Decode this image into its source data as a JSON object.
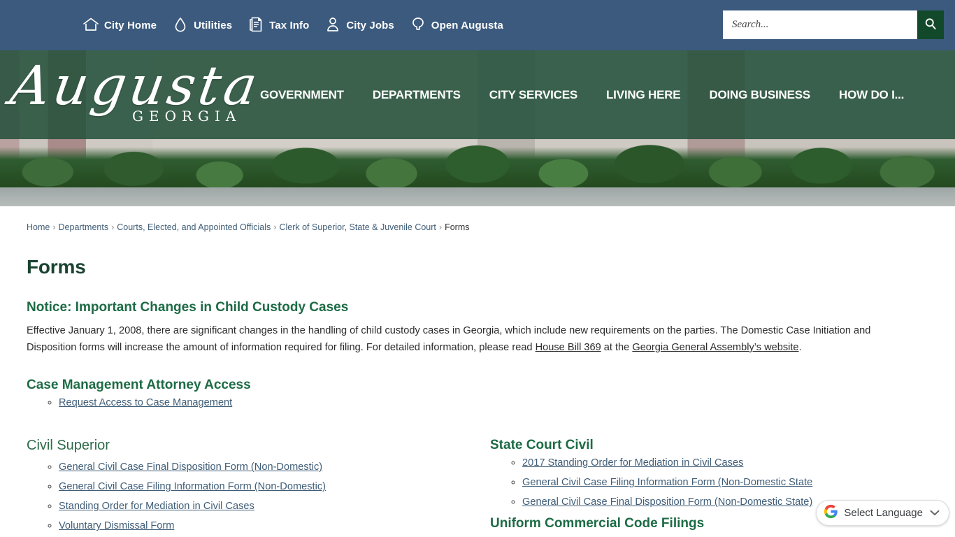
{
  "topbar": {
    "background": "#3b5a7e",
    "quick_links": [
      {
        "label": "City Home",
        "icon": "home-icon"
      },
      {
        "label": "Utilities",
        "icon": "water-drop-icon"
      },
      {
        "label": "Tax Info",
        "icon": "document-icon"
      },
      {
        "label": "City Jobs",
        "icon": "person-icon"
      },
      {
        "label": "Open Augusta",
        "icon": "tree-icon"
      }
    ],
    "search": {
      "placeholder": "Search...",
      "value": "",
      "button_icon": "search-icon",
      "button_color": "#13492b"
    }
  },
  "banner": {
    "logo_script": "Augusta",
    "logo_sub": "GEORGIA",
    "overlay_color": "#224f39",
    "nav": [
      {
        "label": "GOVERNMENT"
      },
      {
        "label": "DEPARTMENTS"
      },
      {
        "label": "CITY SERVICES"
      },
      {
        "label": "LIVING HERE"
      },
      {
        "label": "DOING BUSINESS"
      },
      {
        "label": "HOW DO I..."
      }
    ]
  },
  "breadcrumb": {
    "items": [
      "Home",
      "Departments",
      "Courts, Elected, and Appointed Officials",
      "Clerk of Superior, State & Juvenile Court"
    ],
    "current": "Forms",
    "separator": "›"
  },
  "main": {
    "page_title": "Forms",
    "notice": {
      "heading": "Notice: Important Changes in Child Custody Cases",
      "paragraph_part1": "Effective January 1, 2008, there are significant changes in the handling of child custody cases in Georgia, which include new requirements on the parties. The Domestic Case Initiation and Disposition forms will increase the amount of information required for filing. For detailed information, please read ",
      "link1": "House Bill 369",
      "paragraph_part2": " at the ",
      "link2": "Georgia General Assembly’s website",
      "paragraph_part3": "."
    },
    "case_management": {
      "heading": "Case Management Attorney Access",
      "links": [
        "Request Access to Case Management"
      ]
    },
    "columns": {
      "left": {
        "heading": "Civil Superior",
        "links": [
          "General Civil Case Final Disposition Form (Non-Domestic)",
          "General Civil Case Filing Information Form (Non-Domestic)",
          "Standing Order for Mediation in Civil Cases",
          "Voluntary Dismissal Form"
        ]
      },
      "right": {
        "heading": "State Court Civil",
        "links": [
          "2017 Standing Order for Mediation in Civil Cases",
          "General Civil Case Filing Information Form (Non-Domestic State",
          "General Civil Case Final Disposition Form (Non-Domestic State)"
        ],
        "heading2": "Uniform Commercial Code Filings"
      }
    }
  },
  "translate_widget": {
    "label": "Select Language",
    "icon": "google-g-icon",
    "caret": "⌄"
  }
}
